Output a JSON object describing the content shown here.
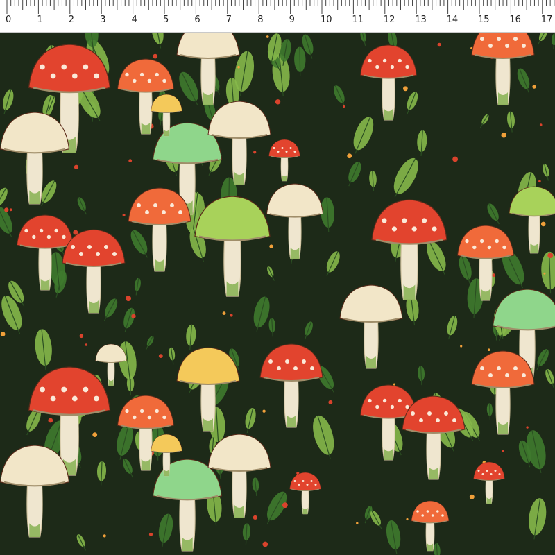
{
  "ruler": {
    "labels": [
      "0",
      "1",
      "2",
      "3",
      "4",
      "5",
      "6",
      "7",
      "8",
      "9",
      "10",
      "11",
      "12",
      "13",
      "14",
      "15",
      "16",
      "17"
    ]
  },
  "colors": {
    "background": "#1d2a18",
    "cap_red": "#e2442e",
    "cap_orange": "#f06a3a",
    "cap_cream": "#f2e6c8",
    "cap_green": "#8fd68b",
    "cap_lime": "#a8d25a",
    "cap_yellow": "#f4c95a",
    "stem": "#efe6cf",
    "leaf_dark": "#3f7a2e",
    "leaf_light": "#86b84a"
  },
  "artwork": {
    "subject_icon": "mushroom-pattern-icon"
  }
}
